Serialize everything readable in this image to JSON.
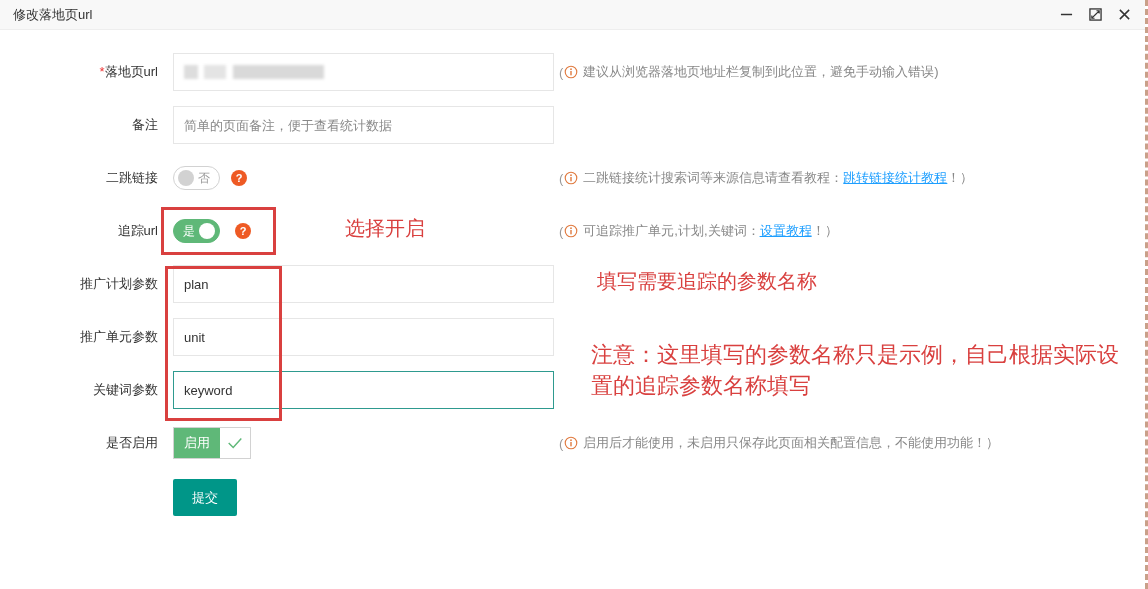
{
  "window": {
    "title": "修改落地页url"
  },
  "form": {
    "rows": [
      {
        "kind": "input",
        "label": "落地页url",
        "required_mark": "*",
        "obscured": true,
        "focused": false,
        "hint": {
          "open": "(",
          "text": "建议从浏览器落地页地址栏复制到此位置，避免手动输入错误)"
        }
      },
      {
        "kind": "input",
        "label": "备注",
        "placeholder": "简单的页面备注，便于查看统计数据",
        "obscured": false,
        "focused": false
      },
      {
        "kind": "toggle",
        "label": "二跳链接",
        "on": false,
        "state_text": "否",
        "help": "?",
        "hint": {
          "open": "(",
          "text": "二跳链接统计搜索词等来源信息请查看教程：",
          "link": "跳转链接统计教程",
          "close": "！）"
        }
      },
      {
        "kind": "toggle",
        "label": "追踪url",
        "on": true,
        "state_text": "是",
        "help": "?",
        "hint": {
          "open": "(",
          "text": "可追踪推广单元,计划,关键词：",
          "link": "设置教程",
          "close": "！）"
        }
      },
      {
        "kind": "input",
        "label": "推广计划参数",
        "value": "plan",
        "obscured": false,
        "focused": false
      },
      {
        "kind": "input",
        "label": "推广单元参数",
        "value": "unit",
        "obscured": false,
        "focused": false
      },
      {
        "kind": "input",
        "label": "关键词参数",
        "value": "keyword",
        "obscured": false,
        "focused": true
      },
      {
        "kind": "check",
        "label": "是否启用",
        "checked": true,
        "check_text": "启用",
        "hint": {
          "open": "(",
          "text": "启用后才能使用，未启用只保存此页面相关配置信息，不能使用功能！）"
        }
      }
    ],
    "submit": "提交"
  },
  "annotations": [
    {
      "kind": "box"
    },
    {
      "kind": "box"
    },
    {
      "kind": "text",
      "text": "选择开启"
    },
    {
      "kind": "text",
      "text": "填写需要追踪的参数名称"
    },
    {
      "kind": "note",
      "text": "注意：这里填写的参数名称只是示例，自己根据实际设置的追踪参数名称填写"
    }
  ]
}
